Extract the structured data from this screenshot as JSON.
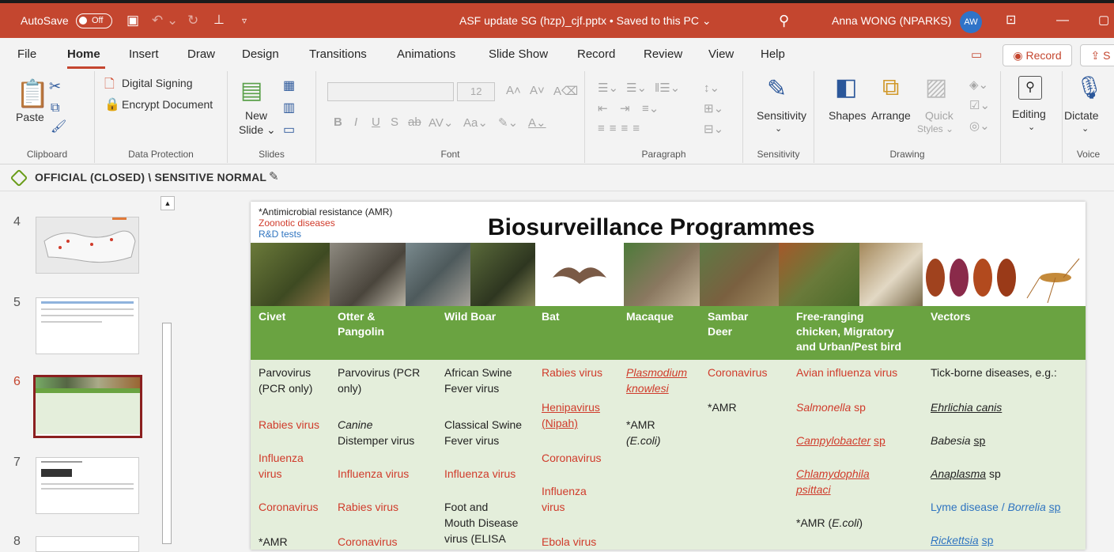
{
  "titlebar": {
    "autosave_label": "AutoSave",
    "autosave_state": "Off",
    "doc_title": "ASF update SG (hzp)_cjf.pptx • Saved to this PC ⌄",
    "user_name": "Anna WONG (NPARKS)",
    "avatar_initials": "AW"
  },
  "menu": {
    "tabs": [
      "File",
      "Home",
      "Insert",
      "Draw",
      "Design",
      "Transitions",
      "Animations",
      "Slide Show",
      "Record",
      "Review",
      "View",
      "Help"
    ],
    "record_button": "◉ Record",
    "share_button": "⇪ S"
  },
  "ribbon": {
    "clipboard": {
      "paste": "Paste",
      "label": "Clipboard"
    },
    "data_protection": {
      "digital_signing": "Digital Signing",
      "encrypt": "Encrypt Document",
      "label": "Data Protection"
    },
    "slides": {
      "new_slide": "New",
      "new_slide2": "Slide ⌄",
      "label": "Slides"
    },
    "font": {
      "size": "12",
      "label": "Font"
    },
    "paragraph": {
      "label": "Paragraph"
    },
    "sensitivity": {
      "button": "Sensitivity",
      "label": "Sensitivity"
    },
    "drawing": {
      "shapes": "Shapes",
      "arrange": "Arrange",
      "quick": "Quick",
      "styles": "Styles ⌄",
      "label": "Drawing"
    },
    "editing": {
      "button": "Editing"
    },
    "voice": {
      "dictate": "Dictate",
      "label": "Voice"
    }
  },
  "sensitivity_bar": {
    "text": "OFFICIAL (CLOSED) \\ SENSITIVE NORMAL"
  },
  "thumbnails": [
    {
      "num": "4"
    },
    {
      "num": "5"
    },
    {
      "num": "6"
    },
    {
      "num": "7"
    },
    {
      "num": "8"
    }
  ],
  "slide": {
    "legend_black": "*Antimicrobial resistance (AMR)",
    "legend_red": "Zoonotic diseases",
    "legend_blue": "R&D tests",
    "title": "Biosurveillance Programmes",
    "headers": {
      "civet": "Civet",
      "otter1": "Otter &",
      "otter2": "Pangolin",
      "boar": "Wild Boar",
      "bat": "Bat",
      "macaque": "Macaque",
      "sambar1": "Sambar",
      "sambar2": "Deer",
      "chicken1": "Free-ranging",
      "chicken2": "chicken, Migratory",
      "chicken3": "and Urban/Pest bird",
      "vectors": "Vectors"
    },
    "civet": [
      "Parvovirus",
      "(PCR only)",
      "Rabies virus",
      "Influenza",
      "virus",
      "Coronavirus",
      "*AMR"
    ],
    "otter": [
      "Parvovirus (PCR",
      "only)",
      "Canine",
      "Distemper virus",
      "Influenza virus",
      "Rabies virus",
      "Coronavirus"
    ],
    "boar": [
      "African Swine",
      "Fever virus",
      "Classical Swine",
      "Fever virus",
      "Influenza virus",
      "Foot and",
      "Mouth Disease",
      "virus (ELISA"
    ],
    "bat": [
      "Rabies virus",
      "Henipavirus",
      "(Nipah)",
      "Coronavirus",
      "Influenza",
      "virus",
      "Ebola virus"
    ],
    "macaque": [
      "Plasmodium",
      "knowlesi",
      "*AMR",
      "(E.coli)"
    ],
    "sambar": [
      "Coronavirus",
      "*AMR"
    ],
    "chicken": [
      "Avian influenza virus",
      "Salmonella",
      "sp",
      "Campylobacter",
      "sp",
      "Chlamydophila",
      "psittaci",
      "*AMR (",
      "E.coli",
      ")"
    ],
    "vectors": [
      "Tick-borne diseases, e.g.:",
      "Ehrlichia canis",
      "Babesia",
      "sp",
      "Anaplasma",
      "sp",
      "Lyme disease / ",
      "Borrelia",
      "sp",
      "Rickettsia",
      "sp"
    ]
  },
  "colors": {
    "accent": "#c4462f",
    "green_header": "#6aa341",
    "zoonotic_red": "#d03b2b",
    "rnd_blue": "#2f74c0"
  }
}
